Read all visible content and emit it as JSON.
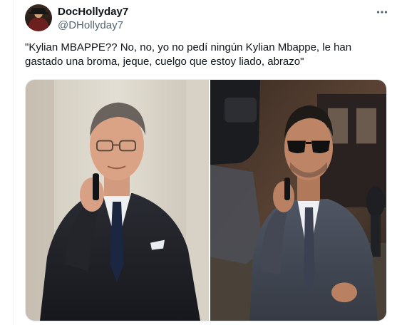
{
  "tweet": {
    "display_name": "DocHollyday7",
    "handle": "@DHollyday7",
    "text": "\"Kylian MBAPPE?? No, no, yo no pedí ningún Kylian Mbappe, le han gastado una broma, jeque, cuelgo que estoy liado, abrazo\"",
    "more_icon": "more-horizontal-icon"
  },
  "media": {
    "photos": [
      {
        "subject": "older man in suit on phone"
      },
      {
        "subject": "man in sunglasses and suit on phone"
      }
    ]
  }
}
